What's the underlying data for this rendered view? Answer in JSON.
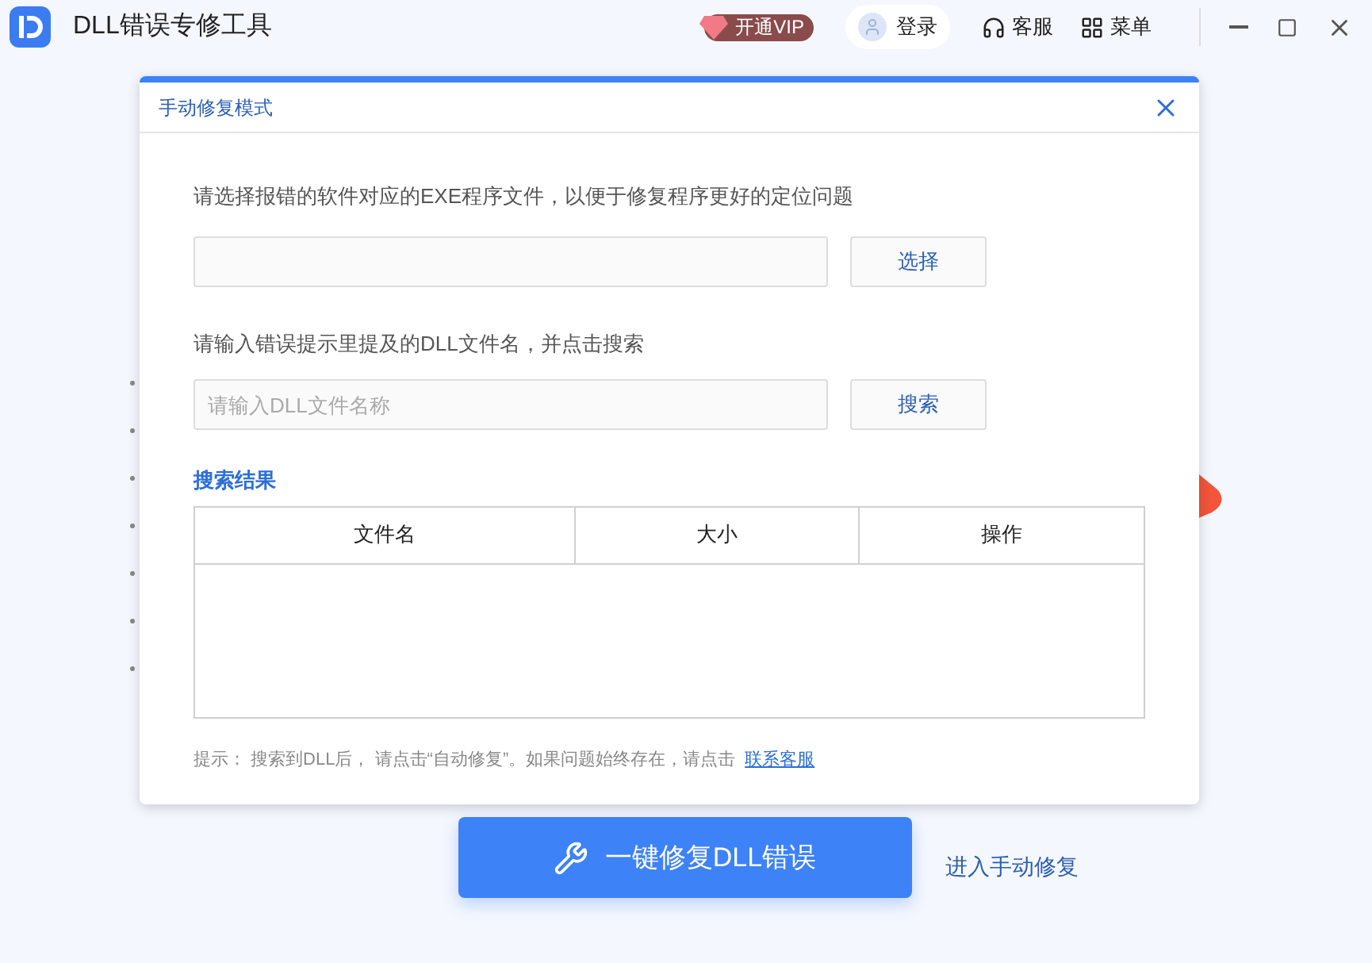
{
  "app": {
    "title": "DLL错误专修工具"
  },
  "header": {
    "vip": "开通VIP",
    "login": "登录",
    "service": "客服",
    "menu": "菜单"
  },
  "dialog": {
    "title": "手动修复模式",
    "exe_prompt": "请选择报错的软件对应的EXE程序文件，以便于修复程序更好的定位问题",
    "choose_button": "选择",
    "dll_prompt": "请输入错误提示里提及的DLL文件名，并点击搜索",
    "dll_field": {
      "placeholder": "请输入DLL文件名称"
    },
    "search_button": "搜索",
    "results_title": "搜索结果",
    "table": {
      "columns": [
        "文件名",
        "大小",
        "操作"
      ]
    },
    "hint": "提示： 搜索到DLL后， 请点击“自动修复”。如果问题始终存在，请点击",
    "hint_link": "联系客服"
  },
  "main": {
    "repair_button": "一键修复DLL错误",
    "manual_link": "进入手动修复"
  }
}
